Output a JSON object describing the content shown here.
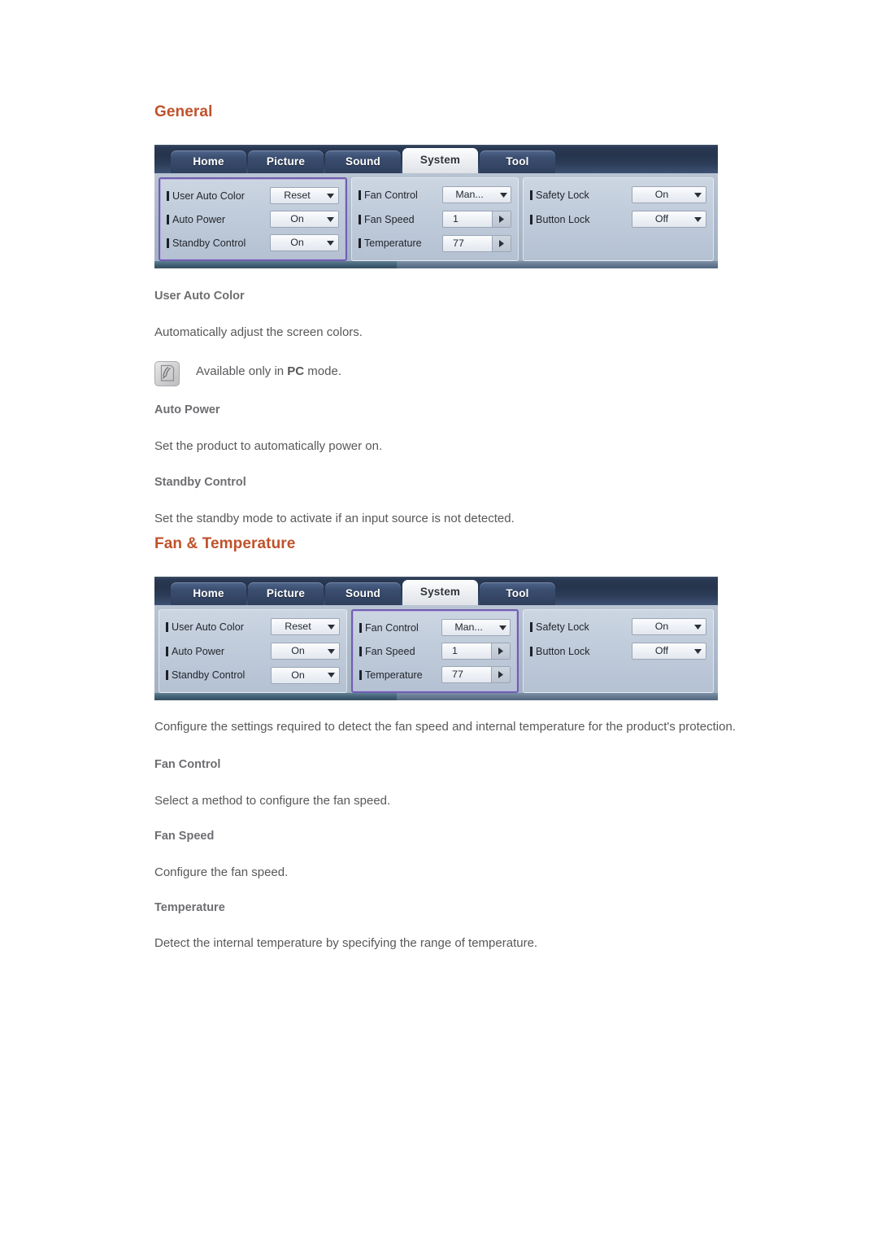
{
  "sections": [
    {
      "heading": "General",
      "osd": {
        "tabs": [
          {
            "label": "Home",
            "active": false
          },
          {
            "label": "Picture",
            "active": false
          },
          {
            "label": "Sound",
            "active": false
          },
          {
            "label": "System",
            "active": true
          },
          {
            "label": "Tool",
            "active": false
          }
        ],
        "highlighted_panel": 0,
        "panels": [
          {
            "rows": [
              {
                "label": "User Auto Color",
                "value": "Reset",
                "control": "dropdown"
              },
              {
                "label": "Auto Power",
                "value": "On",
                "control": "dropdown"
              },
              {
                "label": "Standby Control",
                "value": "On",
                "control": "dropdown"
              }
            ]
          },
          {
            "rows": [
              {
                "label": "Fan Control",
                "value": "Man...",
                "control": "dropdown"
              },
              {
                "label": "Fan Speed",
                "value": "1",
                "control": "spinner"
              },
              {
                "label": "Temperature",
                "value": "77",
                "control": "spinner"
              }
            ]
          },
          {
            "rows": [
              {
                "label": "Safety Lock",
                "value": "On",
                "control": "dropdown"
              },
              {
                "label": "Button Lock",
                "value": "Off",
                "control": "dropdown"
              }
            ]
          }
        ]
      },
      "entries": [
        {
          "title": "User Auto Color",
          "body": "Automatically adjust the screen colors.",
          "note": {
            "prefix": "Available only in ",
            "bold": "PC",
            "suffix": " mode.",
            "icon": "note-pencil-icon"
          }
        },
        {
          "title": "Auto Power",
          "body": "Set the product to automatically power on."
        },
        {
          "title": "Standby Control",
          "body": "Set the standby mode to activate if an input source is not detected."
        }
      ]
    },
    {
      "heading": "Fan & Temperature",
      "osd": {
        "tabs": [
          {
            "label": "Home",
            "active": false
          },
          {
            "label": "Picture",
            "active": false
          },
          {
            "label": "Sound",
            "active": false
          },
          {
            "label": "System",
            "active": true
          },
          {
            "label": "Tool",
            "active": false
          }
        ],
        "highlighted_panel": 1,
        "panels": [
          {
            "rows": [
              {
                "label": "User Auto Color",
                "value": "Reset",
                "control": "dropdown"
              },
              {
                "label": "Auto Power",
                "value": "On",
                "control": "dropdown"
              },
              {
                "label": "Standby Control",
                "value": "On",
                "control": "dropdown"
              }
            ]
          },
          {
            "rows": [
              {
                "label": "Fan Control",
                "value": "Man...",
                "control": "dropdown"
              },
              {
                "label": "Fan Speed",
                "value": "1",
                "control": "spinner"
              },
              {
                "label": "Temperature",
                "value": "77",
                "control": "spinner"
              }
            ]
          },
          {
            "rows": [
              {
                "label": "Safety Lock",
                "value": "On",
                "control": "dropdown"
              },
              {
                "label": "Button Lock",
                "value": "Off",
                "control": "dropdown"
              }
            ]
          }
        ]
      },
      "intro": "Configure the settings required to detect the fan speed and internal temperature for the product's protection.",
      "entries": [
        {
          "title": "Fan Control",
          "body": "Select a method to configure the fan speed."
        },
        {
          "title": "Fan Speed",
          "body": "Configure the fan speed."
        },
        {
          "title": "Temperature",
          "body": "Detect the internal temperature by specifying the range of temperature."
        }
      ]
    }
  ],
  "colors": {
    "heading_orange": "#c0522b",
    "subheading_grey": "#6e6e72",
    "body_grey": "#58585b",
    "highlight_purple": "#6f5fb0",
    "osd_tabbar_dark": "#2b3c57",
    "osd_panel_blue": "#c2cddc"
  }
}
